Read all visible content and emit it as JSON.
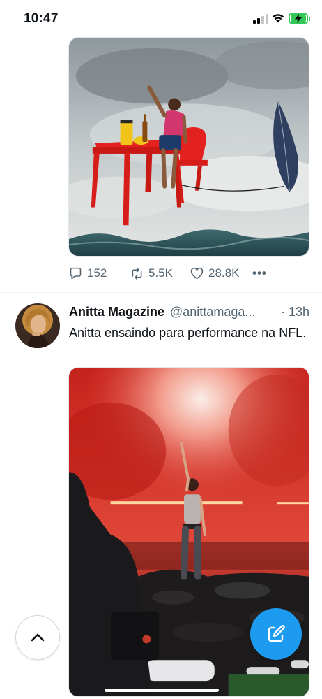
{
  "status_bar": {
    "time": "10:47",
    "battery_color": "#34c759"
  },
  "tweet_1": {
    "media_description_icon": "image",
    "actions": {
      "replies": "152",
      "retweets": "5.5K",
      "likes": "28.8K",
      "more_label": "•••"
    }
  },
  "tweet_2": {
    "author_name": "Anitta Magazine",
    "author_handle": "@anittamaga...",
    "time": "· 13h",
    "text": "Anitta ensaindo para performance na NFL."
  },
  "floating": {
    "scroll_top_icon": "chevron-up-icon",
    "compose_icon": "compose-icon",
    "accent_color": "#1d9bf0"
  },
  "colors": {
    "text_primary": "#0f1419",
    "text_secondary": "#536471",
    "divider": "#eff3f4"
  }
}
